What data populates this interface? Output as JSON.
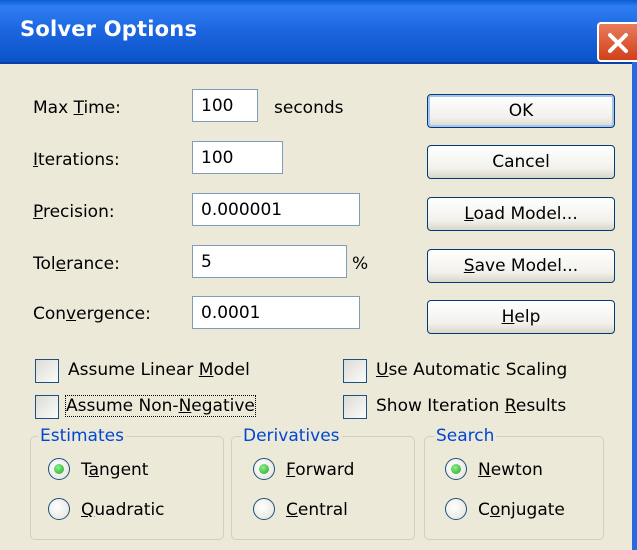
{
  "window": {
    "title": "Solver Options",
    "close_icon": "close-icon"
  },
  "fields": {
    "max_time": {
      "label_pre": "Max ",
      "label_u": "T",
      "label_post": "ime:",
      "value": "100",
      "unit": "seconds"
    },
    "iterations": {
      "label_pre": "",
      "label_u": "I",
      "label_post": "terations:",
      "value": "100"
    },
    "precision": {
      "label_pre": "",
      "label_u": "P",
      "label_post": "recision:",
      "value": "0.000001"
    },
    "tolerance": {
      "label_pre": "Tol",
      "label_u": "e",
      "label_post": "rance:",
      "value": "5",
      "unit": "%"
    },
    "convergence": {
      "label_pre": "Con",
      "label_u": "v",
      "label_post": "ergence:",
      "value": "0.0001"
    }
  },
  "buttons": {
    "ok": {
      "pre": "OK",
      "u": "",
      "post": ""
    },
    "cancel": {
      "pre": "Cancel",
      "u": "",
      "post": ""
    },
    "load": {
      "pre": "",
      "u": "L",
      "post": "oad Model..."
    },
    "save": {
      "pre": "",
      "u": "S",
      "post": "ave Model..."
    },
    "help": {
      "pre": "",
      "u": "H",
      "post": "elp"
    }
  },
  "checkboxes": {
    "linear": {
      "pre": "Assume Linear ",
      "u": "M",
      "post": "odel",
      "checked": false
    },
    "nonneg": {
      "pre": "Assume Non-",
      "u": "N",
      "post": "egative",
      "checked": false
    },
    "scaling": {
      "pre": "",
      "u": "U",
      "post": "se Automatic Scaling",
      "checked": false
    },
    "showiter": {
      "pre": "Show Iteration ",
      "u": "R",
      "post": "esults",
      "checked": false
    }
  },
  "groups": {
    "estimates": {
      "title": "Estimates",
      "opt1": {
        "pre": "T",
        "u": "a",
        "post": "ngent",
        "selected": true
      },
      "opt2": {
        "pre": "",
        "u": "Q",
        "post": "uadratic",
        "selected": false
      }
    },
    "derivatives": {
      "title": "Derivatives",
      "opt1": {
        "pre": "",
        "u": "F",
        "post": "orward",
        "selected": true
      },
      "opt2": {
        "pre": "",
        "u": "C",
        "post": "entral",
        "selected": false
      }
    },
    "search": {
      "title": "Search",
      "opt1": {
        "pre": "",
        "u": "N",
        "post": "ewton",
        "selected": true
      },
      "opt2": {
        "pre": "C",
        "u": "o",
        "post": "njugate",
        "selected": false
      }
    }
  },
  "colors": {
    "titlebar": "#1b66e0",
    "group_title": "#0046d5",
    "radio_selected": "#1fa41f"
  }
}
